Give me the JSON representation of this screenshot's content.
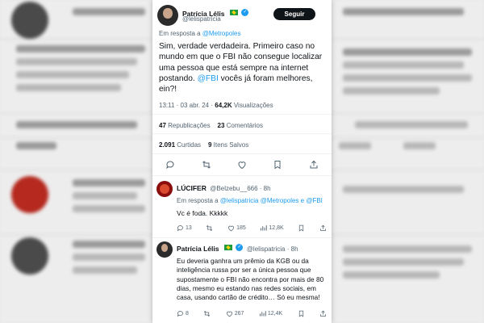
{
  "main_tweet": {
    "name": "Patrícia Lélis",
    "handle": "@lelispatricia",
    "follow_label": "Seguir",
    "reply_prefix": "Em resposta a",
    "reply_to": "@Metropoles",
    "text_part1": "Sim, verdade verdadeira. Primeiro caso no mundo em que o FBI não consegue localizar uma pessoa que está sempre na internet postando.",
    "text_mention": "@FBI",
    "text_part2": "vocês já foram melhores, ein?!",
    "time": "13:11 · 03 abr. 24 ·",
    "views": "64,2K",
    "views_label": "Visualizações",
    "reposts": "47",
    "reposts_label": "Republicações",
    "quotes": "23",
    "quotes_label": "Comentários",
    "likes": "2.091",
    "likes_label": "Curtidas",
    "bookmarks": "9",
    "bookmarks_label": "Itens Salvos"
  },
  "reply1": {
    "name": "LÚCIFER",
    "handle": "@Belzebu__666 · 8h",
    "reply_prefix": "Em resposta a",
    "reply_to": "@lelispatricia @Metropoles e @FBI",
    "text": "Vc é foda. Kkkkk",
    "replies": "13",
    "likes": "185",
    "views": "12,8K"
  },
  "reply2": {
    "name": "Patrícia Lélis",
    "handle": "@lelispatricia · 8h",
    "text": "Eu deveria ganhra um prêmio da KGB ou da inteligência russa por ser a única pessoa que supostamente o FBI não encontra por mais de 80 dias, mesmo eu estando nas redes sociais, em casa, usando cartão de crédito… Só eu mesma!",
    "replies": "8",
    "likes": "267",
    "views": "12,4K"
  },
  "colors": {
    "accent": "#1d9bf0",
    "text": "#0f1419",
    "muted": "#536471"
  },
  "icons": [
    "verified-badge-icon",
    "brazil-flag-icon",
    "reply-icon",
    "repost-icon",
    "like-icon",
    "bookmark-icon",
    "share-icon",
    "views-icon"
  ]
}
